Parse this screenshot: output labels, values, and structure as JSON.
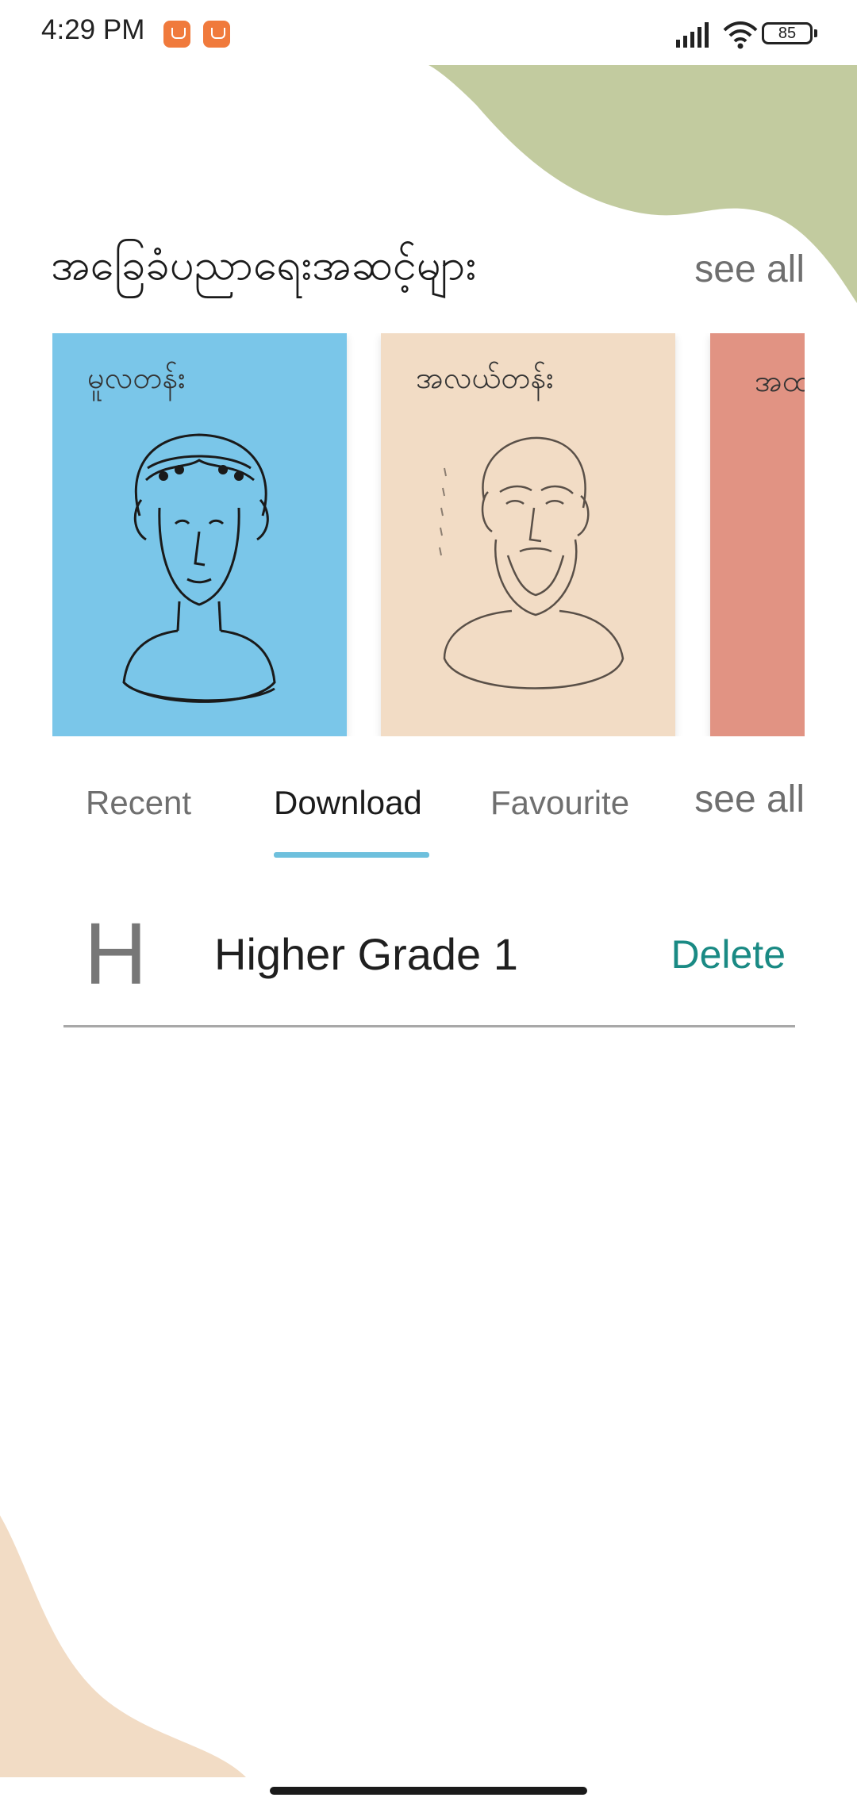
{
  "status_bar": {
    "time": "4:29 PM",
    "battery": "85",
    "icons": [
      "app-notification-icon",
      "app-notification-icon",
      "signal-icon",
      "wifi-icon",
      "battery-icon"
    ]
  },
  "section": {
    "title": "အခြေခံပညာရေးအဆင့်များ",
    "see_all": "see all"
  },
  "cards": [
    {
      "label": "မူလတန်း",
      "bg": "#7ac6e9",
      "illustration": "female-bust"
    },
    {
      "label": "အလယ်တန်း",
      "bg": "#f2dcc5",
      "illustration": "bearded-bust"
    },
    {
      "label": "အထ",
      "bg": "#e19383",
      "illustration": ""
    }
  ],
  "tabs": {
    "items": [
      "Recent",
      "Download",
      "Favourite"
    ],
    "active": "Download",
    "see_all": "see all",
    "underline_color": "#6ec0dd"
  },
  "downloads": [
    {
      "initial": "H",
      "title": "Higher Grade 1",
      "action": "Delete"
    }
  ],
  "colors": {
    "accent": "#1a8a84",
    "blob_green": "#c2cb9f",
    "blob_peach": "#f2dcc5"
  }
}
